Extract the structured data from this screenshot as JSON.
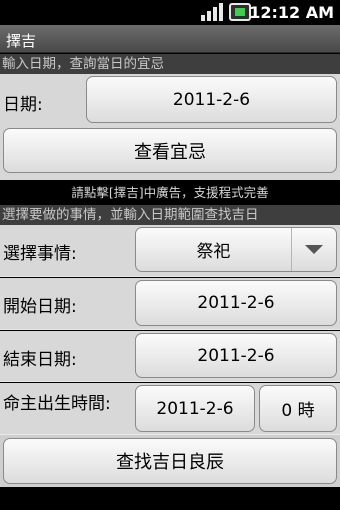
{
  "status_bar": {
    "time": "12:12 AM",
    "icons": [
      "signal-icon",
      "battery-icon"
    ]
  },
  "app": {
    "title": "擇吉"
  },
  "section1": {
    "hint": "輸入日期，查詢當日的宜忌",
    "date_label": "日期:",
    "date_value": "2011-2-6",
    "check_button": "查看宜忌"
  },
  "ad_notice": "請點擊[擇吉]中廣告，支援程式完善",
  "section2": {
    "hint": "選擇要做的事情，並輸入日期範圍查找吉日",
    "event_label": "選擇事情:",
    "event_value": "祭祀",
    "start_label": "開始日期:",
    "start_value": "2011-2-6",
    "end_label": "結束日期:",
    "end_value": "2011-2-6",
    "birth_label": "命主出生時間:",
    "birth_date": "2011-2-6",
    "birth_hour": "0 時",
    "search_button": "查找吉日良辰"
  },
  "colors": {
    "title_bar": "#555555",
    "panel": "#d7d7d7",
    "background": "#000000"
  }
}
